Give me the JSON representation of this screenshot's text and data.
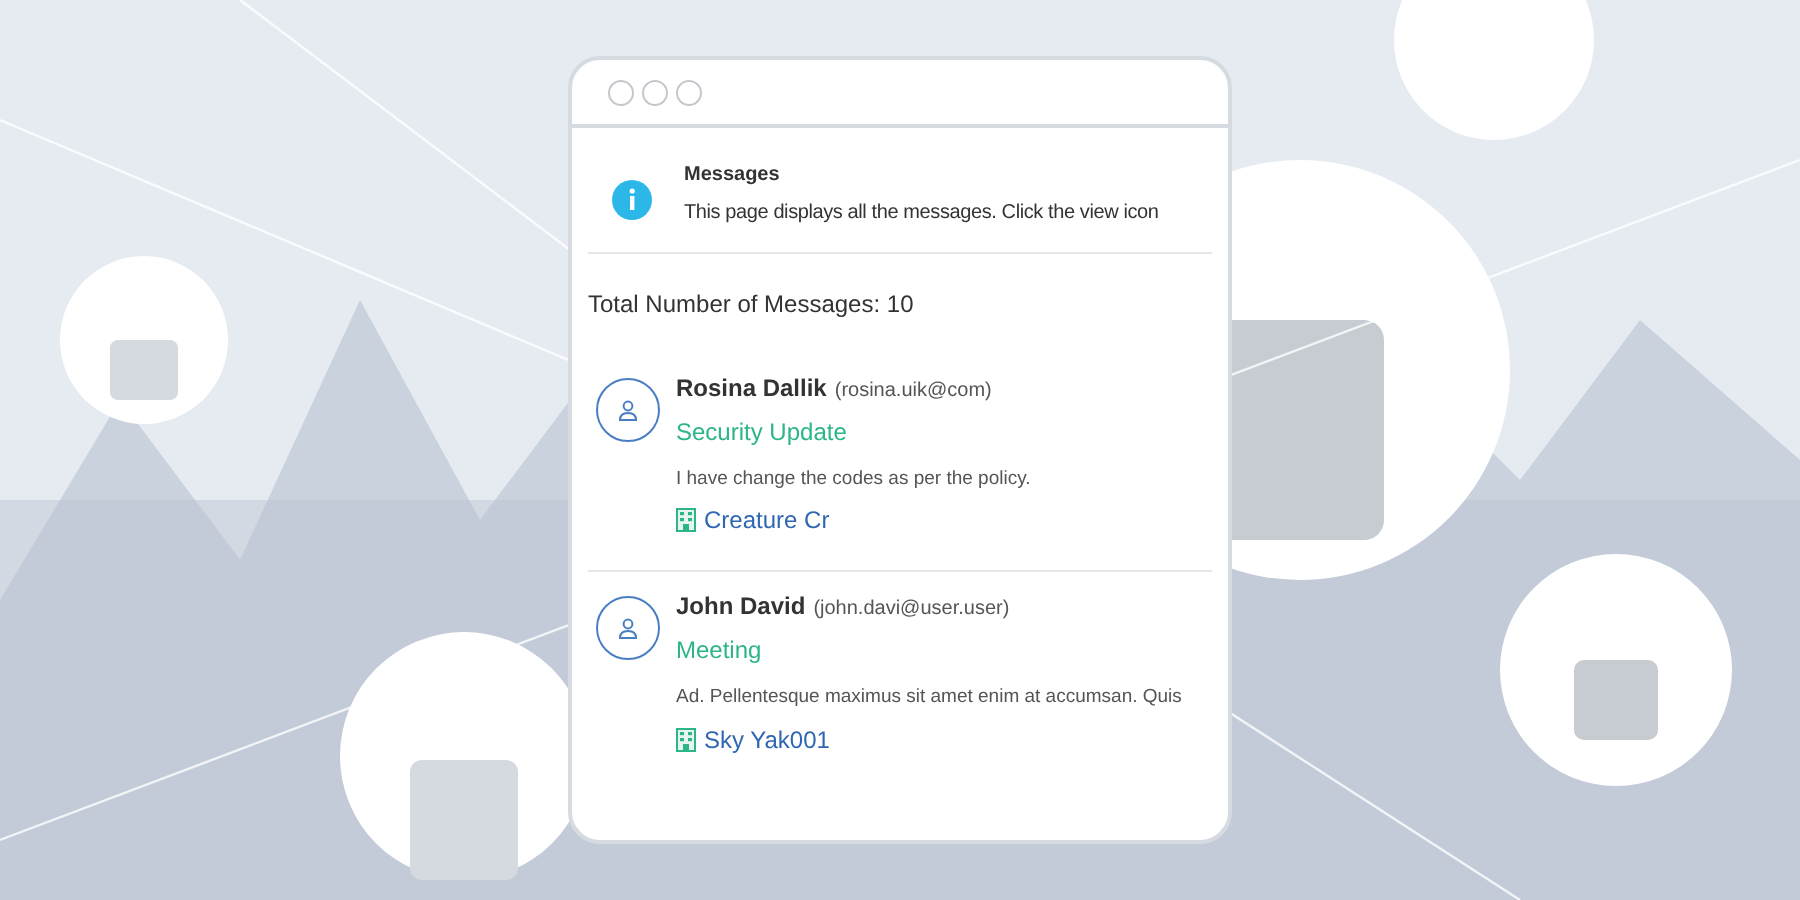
{
  "info": {
    "title": "Messages",
    "text": "This page displays all the messages. Click the view icon"
  },
  "total": "Total Number of Messages: 10",
  "messages": [
    {
      "name": "Rosina Dallik",
      "email": "(rosina.uik@com)",
      "subject": "Security Update",
      "body": "I have change the codes as per the policy.",
      "company": "Creature Cr"
    },
    {
      "name": "John David",
      "email": "(john.davi@user.user)",
      "subject": "Meeting",
      "body": "Ad. Pellentesque maximus sit amet enim at accumsan. Quis",
      "company": "Sky Yak001"
    }
  ]
}
